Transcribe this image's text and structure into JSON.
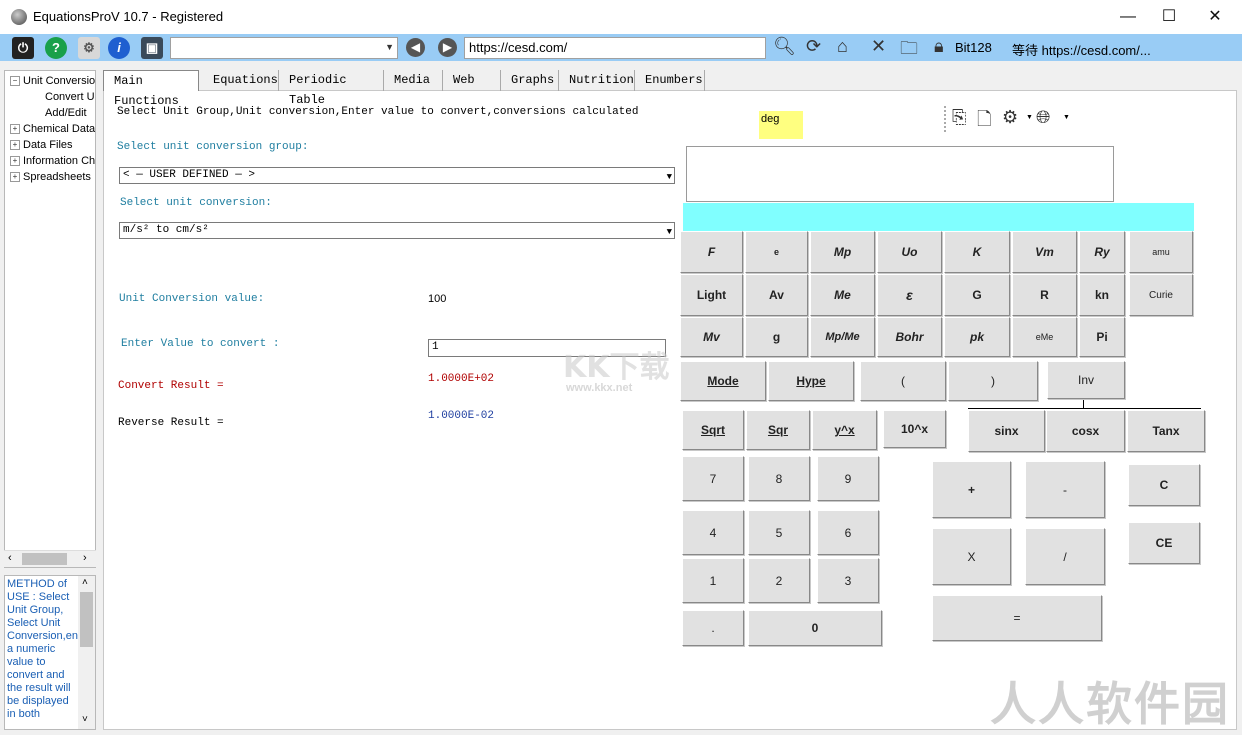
{
  "window": {
    "title": "EquationsProV 10.7 - Registered",
    "minimize": "—",
    "maximize": "☐",
    "close": "✕"
  },
  "toolbar": {
    "url": "https://cesd.com/",
    "bit_label": "Bit128",
    "status_text": "等待 https://cesd.com/..."
  },
  "tree": {
    "items": [
      {
        "label": "Unit Conversion",
        "toggle": "−"
      },
      {
        "label": "Convert Units"
      },
      {
        "label": "Add/Edit"
      },
      {
        "label": "Chemical Data",
        "toggle": "+"
      },
      {
        "label": "Data Files",
        "toggle": "+"
      },
      {
        "label": "Information Ch",
        "toggle": "+"
      },
      {
        "label": "Spreadsheets",
        "toggle": "+"
      }
    ]
  },
  "description": "METHOD of USE : Select Unit Group, Select Unit Conversion,enter a numeric value to convert and the result will be displayed in both",
  "tabs": [
    "Main Functions",
    "Equations",
    "Periodic Table",
    "Media",
    "Web",
    "Graphs",
    "Nutrition",
    "Enumbers"
  ],
  "main": {
    "instructions": "Select Unit Group,Unit conversion,Enter value to convert,conversions calculated",
    "group_label": "Select unit conversion group:",
    "group_value": "< — USER DEFINED — >",
    "conversion_label": "Select unit conversion:",
    "conversion_value": "m/s² to cm/s²",
    "unit_value_label": "Unit Conversion value:",
    "unit_value": "100",
    "enter_label": "Enter Value to convert :",
    "enter_value": "1",
    "convert_label": "Convert Result =",
    "convert_value": "1.0000E+02",
    "reverse_label": "Reverse Result =",
    "reverse_value": "1.0000E-02"
  },
  "calculator": {
    "angle_mode": "deg",
    "row1": [
      "F",
      "e",
      "Mp",
      "Uo",
      "K",
      "Vm",
      "Ry",
      "amu"
    ],
    "row2": [
      "Light",
      "Av",
      "Me",
      "ε",
      "G",
      "R",
      "kn",
      "Curie"
    ],
    "row3": [
      "Mv",
      "g",
      "Mp/Me",
      "Bohr",
      "pk",
      "eMe",
      "Pi"
    ],
    "mode": "Mode",
    "hype": "Hype",
    "lparen": "(",
    "rparen": ")",
    "inv": "Inv",
    "sqrt": "Sqrt",
    "sqr": "Sqr",
    "ypow": "y^x",
    "tenpow": "10^x",
    "sinx": "sinx",
    "cosx": "cosx",
    "tanx": "Tanx",
    "digits": [
      "7",
      "8",
      "9",
      "4",
      "5",
      "6",
      "1",
      "2",
      "3"
    ],
    "dot": ".",
    "zero": "0",
    "plus": "+",
    "minus": "-",
    "times": "X",
    "divide": "/",
    "equals": "=",
    "clear": "C",
    "clear_entry": "CE"
  },
  "watermarks": {
    "kk": "KK下载",
    "kk_url": "www.kkx.net",
    "rr": "人人软件园"
  }
}
